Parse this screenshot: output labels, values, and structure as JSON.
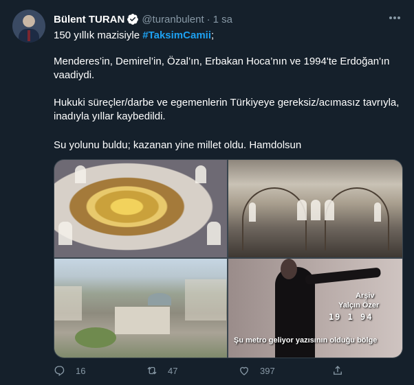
{
  "author": {
    "name": "Bülent TURAN",
    "handle": "@turanbulent",
    "separator": "·",
    "time": "1 sa",
    "verified": true
  },
  "tweet": {
    "line1_prefix": "150 yıllık mazisiyle ",
    "hashtag": "#TaksimCamii",
    "line1_suffix": ";",
    "paragraph2": "Menderes’in, Demirel’in, Özal’ın, Erbakan Hoca’nın ve 1994'te Erdoğan'ın vaadiydi.",
    "paragraph3": "Hukuki süreçler/darbe ve egemenlerin Türkiyeye gereksiz/acımasız tavrıyla, inadıyla yıllar kaybedildi.",
    "paragraph4": "Su yolunu buldu; kazanan yine millet oldu. Hamdolsun"
  },
  "media": {
    "image4_overlay": {
      "label1": "Arşiv",
      "label2": "Yalçın Özer",
      "date": "19  1  94",
      "caption": "Şu metro geliyor yazısının olduğu bölge"
    }
  },
  "actions": {
    "replies": "16",
    "retweets": "47",
    "likes": "397"
  },
  "icons": {
    "more": "more-icon",
    "verified": "verified-badge-icon",
    "reply": "reply-icon",
    "retweet": "retweet-icon",
    "like": "heart-icon",
    "share": "share-icon"
  },
  "colors": {
    "background": "#15202b",
    "accent": "#1da1f2",
    "secondary_text": "#8899a6",
    "border": "#38444d"
  }
}
